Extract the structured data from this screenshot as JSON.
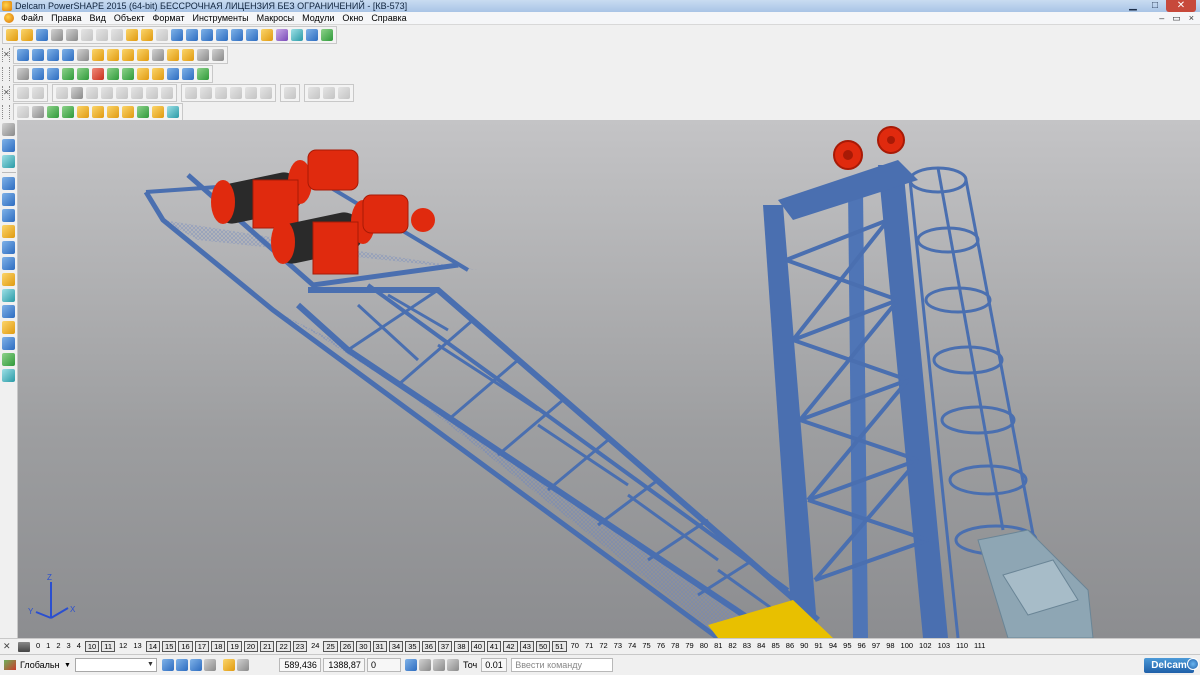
{
  "window": {
    "title": "Delcam PowerSHAPE 2015 (64-bit) БЕССРОЧНАЯ ЛИЦЕНЗИЯ БЕЗ ОГРАНИЧЕНИЙ - [КВ-573]",
    "minimize": "▁",
    "maximize": "□",
    "close": "✕"
  },
  "menu": {
    "items": [
      "Файл",
      "Правка",
      "Вид",
      "Объект",
      "Формат",
      "Инструменты",
      "Макросы",
      "Модули",
      "Окно",
      "Справка"
    ],
    "mdi_minimize": "–",
    "mdi_restore": "▭",
    "mdi_close": "×"
  },
  "toolbars": {
    "handle_label": "✕"
  },
  "levels": [
    {
      "n": "0",
      "on": false
    },
    {
      "n": "1",
      "on": false
    },
    {
      "n": "2",
      "on": false
    },
    {
      "n": "3",
      "on": false
    },
    {
      "n": "4",
      "on": false
    },
    {
      "n": "10",
      "on": true
    },
    {
      "n": "11",
      "on": true
    },
    {
      "n": "12",
      "on": false
    },
    {
      "n": "13",
      "on": false
    },
    {
      "n": "14",
      "on": true
    },
    {
      "n": "15",
      "on": true
    },
    {
      "n": "16",
      "on": true
    },
    {
      "n": "17",
      "on": true
    },
    {
      "n": "18",
      "on": true
    },
    {
      "n": "19",
      "on": true
    },
    {
      "n": "20",
      "on": true
    },
    {
      "n": "21",
      "on": true
    },
    {
      "n": "22",
      "on": true
    },
    {
      "n": "23",
      "on": true
    },
    {
      "n": "24",
      "on": false
    },
    {
      "n": "25",
      "on": true
    },
    {
      "n": "26",
      "on": true
    },
    {
      "n": "30",
      "on": true
    },
    {
      "n": "31",
      "on": true
    },
    {
      "n": "34",
      "on": true
    },
    {
      "n": "35",
      "on": true
    },
    {
      "n": "36",
      "on": true
    },
    {
      "n": "37",
      "on": true
    },
    {
      "n": "38",
      "on": true
    },
    {
      "n": "40",
      "on": true
    },
    {
      "n": "41",
      "on": true
    },
    {
      "n": "42",
      "on": true
    },
    {
      "n": "43",
      "on": true
    },
    {
      "n": "50",
      "on": true
    },
    {
      "n": "51",
      "on": true
    },
    {
      "n": "70",
      "on": false
    },
    {
      "n": "71",
      "on": false
    },
    {
      "n": "72",
      "on": false
    },
    {
      "n": "73",
      "on": false
    },
    {
      "n": "74",
      "on": false
    },
    {
      "n": "75",
      "on": false
    },
    {
      "n": "76",
      "on": false
    },
    {
      "n": "78",
      "on": false
    },
    {
      "n": "79",
      "on": false
    },
    {
      "n": "80",
      "on": false
    },
    {
      "n": "81",
      "on": false
    },
    {
      "n": "82",
      "on": false
    },
    {
      "n": "83",
      "on": false
    },
    {
      "n": "84",
      "on": false
    },
    {
      "n": "85",
      "on": false
    },
    {
      "n": "86",
      "on": false
    },
    {
      "n": "90",
      "on": false
    },
    {
      "n": "91",
      "on": false
    },
    {
      "n": "94",
      "on": false
    },
    {
      "n": "95",
      "on": false
    },
    {
      "n": "96",
      "on": false
    },
    {
      "n": "97",
      "on": false
    },
    {
      "n": "98",
      "on": false
    },
    {
      "n": "100",
      "on": false
    },
    {
      "n": "102",
      "on": false
    },
    {
      "n": "103",
      "on": false
    },
    {
      "n": "110",
      "on": false
    },
    {
      "n": "111",
      "on": false
    }
  ],
  "status": {
    "workplane": "Глобальн",
    "workplane_arrow": "▼",
    "coord_x": "589,436",
    "coord_y": "1388,87",
    "coord_z": "0",
    "tolerance_label": "Точ",
    "tolerance_value": "0.01",
    "command_placeholder": "Ввести команду",
    "logo": "Delcam"
  },
  "axis": {
    "x_label": "X",
    "y_label": "Y",
    "z_label": "Z"
  },
  "colors": {
    "structure_blue": "#4a6fb0",
    "motor_red": "#e02a0e",
    "drum_black": "#2a2a2a",
    "platform_yellow": "#e8c000",
    "equipment_grey_blue": "#8ea6b4"
  }
}
